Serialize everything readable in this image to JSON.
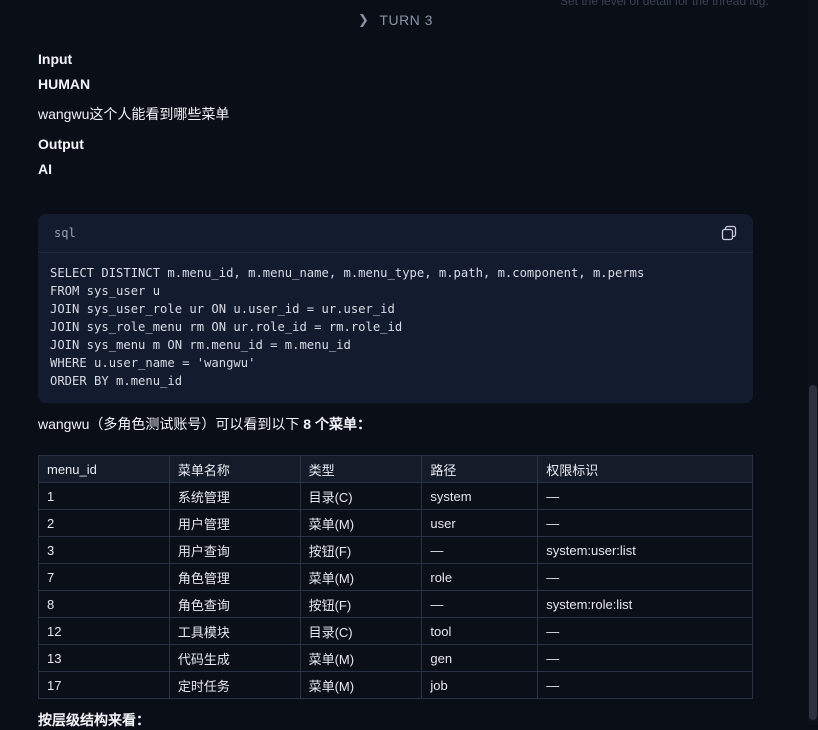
{
  "top_hint": "Set the level of detail for the thread log.",
  "turn": {
    "label": "TURN 3"
  },
  "input": {
    "heading": "Input",
    "role": "HUMAN",
    "message": "wangwu这个人能看到哪些菜单"
  },
  "output": {
    "heading": "Output",
    "role": "AI"
  },
  "code": {
    "language": "sql",
    "lines": [
      "SELECT DISTINCT m.menu_id, m.menu_name, m.menu_type, m.path, m.component, m.perms",
      "FROM sys_user u",
      "JOIN sys_user_role ur ON u.user_id = ur.user_id",
      "JOIN sys_role_menu rm ON ur.role_id = rm.role_id",
      "JOIN sys_menu m ON rm.menu_id = m.menu_id",
      "WHERE u.user_name = 'wangwu'",
      "ORDER BY m.menu_id"
    ]
  },
  "summary": {
    "prefix": "wangwu（多角色测试账号）可以看到以下 ",
    "count": "8 个菜单",
    "suffix": "："
  },
  "table": {
    "headers": [
      "menu_id",
      "菜单名称",
      "类型",
      "路径",
      "权限标识"
    ],
    "rows": [
      [
        "1",
        "系统管理",
        "目录(C)",
        "system",
        "—"
      ],
      [
        "2",
        "用户管理",
        "菜单(M)",
        "user",
        "—"
      ],
      [
        "3",
        "用户查询",
        "按钮(F)",
        "—",
        "system:user:list"
      ],
      [
        "7",
        "角色管理",
        "菜单(M)",
        "role",
        "—"
      ],
      [
        "8",
        "角色查询",
        "按钮(F)",
        "—",
        "system:role:list"
      ],
      [
        "12",
        "工具模块",
        "目录(C)",
        "tool",
        "—"
      ],
      [
        "13",
        "代码生成",
        "菜单(M)",
        "gen",
        "—"
      ],
      [
        "17",
        "定时任务",
        "菜单(M)",
        "job",
        "—"
      ]
    ]
  },
  "footer": "按层级结构来看："
}
